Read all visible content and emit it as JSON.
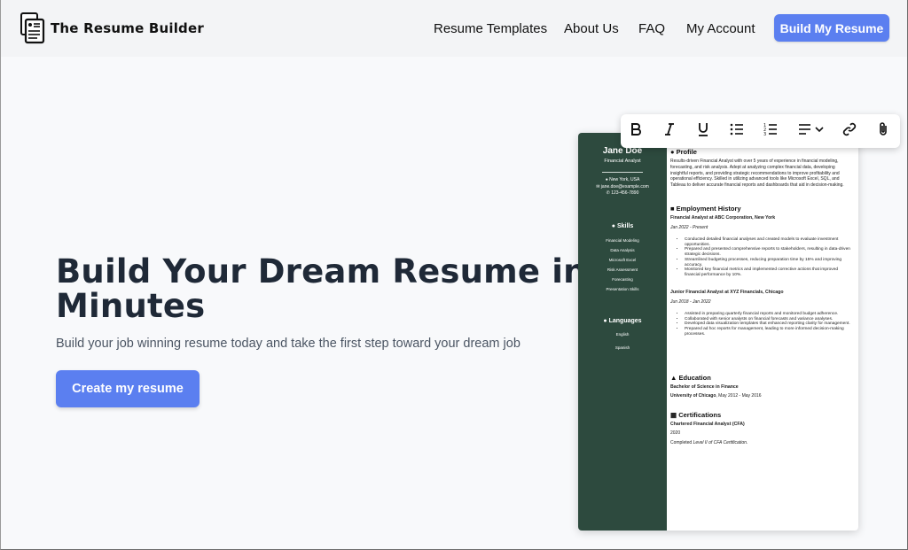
{
  "header": {
    "brand": "The Resume Builder",
    "nav": [
      {
        "label": "Resume Templates"
      },
      {
        "label": "About Us"
      },
      {
        "label": "FAQ"
      },
      {
        "label": "My Account"
      }
    ],
    "cta": "Build My Resume"
  },
  "hero": {
    "title": "Build Your Dream Resume in Minutes",
    "subtitle": "Build your job winning resume today and take the first step toward your dream job",
    "button": "Create my resume"
  },
  "toolbar": {
    "icons": [
      "bold-icon",
      "italic-icon",
      "underline-icon",
      "bullet-list-icon",
      "numbered-list-icon",
      "align-dropdown-icon",
      "link-icon",
      "attach-icon"
    ]
  },
  "resume": {
    "name": "Jane Doe",
    "role": "Financial Analyst",
    "location": "New York, USA",
    "email": "jane.doe@example.com",
    "phone": "123-456-7890",
    "skills_heading": "Skills",
    "skills": [
      "Financial Modeling",
      "Data Analysis",
      "Microsoft Excel",
      "Risk Assessment",
      "Forecasting",
      "Presentation Skills"
    ],
    "languages_heading": "Languages",
    "languages": [
      "English",
      "Spanish"
    ],
    "profile_heading": "Profile",
    "profile_text": "Results-driven Financial Analyst with over 5 years of experience in financial modeling, forecasting, and risk analysis. Adept at analyzing complex financial data, developing insightful reports, and providing strategic recommendations to improve profitability and operational efficiency. Skilled in utilizing advanced tools like Microsoft Excel, SQL, and Tableau to deliver accurate financial reports and dashboards that aid in decision-making.",
    "employment_heading": "Employment History",
    "jobs": [
      {
        "title": "Financial Analyst at ABC Corporation, New York",
        "dates": "Jan 2022 - Present",
        "bullets": [
          "Conducted detailed financial analyses and created models to evaluate investment opportunities.",
          "Prepared and presented comprehensive reports to stakeholders, resulting in data-driven strategic decisions.",
          "Streamlined budgeting processes, reducing preparation time by 15% and improving accuracy.",
          "Monitored key financial metrics and implemented corrective actions that improved financial performance by 10%."
        ]
      },
      {
        "title": "Junior Financial Analyst at XYZ Financials, Chicago",
        "dates": "Jun 2018 - Jan 2022",
        "bullets": [
          "Assisted in preparing quarterly financial reports and monitored budget adherence.",
          "Collaborated with senior analysts on financial forecasts and variance analyses.",
          "Developed data visualization templates that enhanced reporting clarity for management.",
          "Prepared ad hoc reports for management, leading to more informed decision-making processes."
        ]
      }
    ],
    "education_heading": "Education",
    "degree": "Bachelor of Science in Finance",
    "school": "University of Chicago",
    "school_dates": ", May 2012 - May 2016",
    "certs_heading": "Certifications",
    "cert_name": "Chartered Financial Analyst (CFA)",
    "cert_year": "2020",
    "cert_note_prefix": "Completed ",
    "cert_note_italic": "Level II of CFA Certification."
  }
}
